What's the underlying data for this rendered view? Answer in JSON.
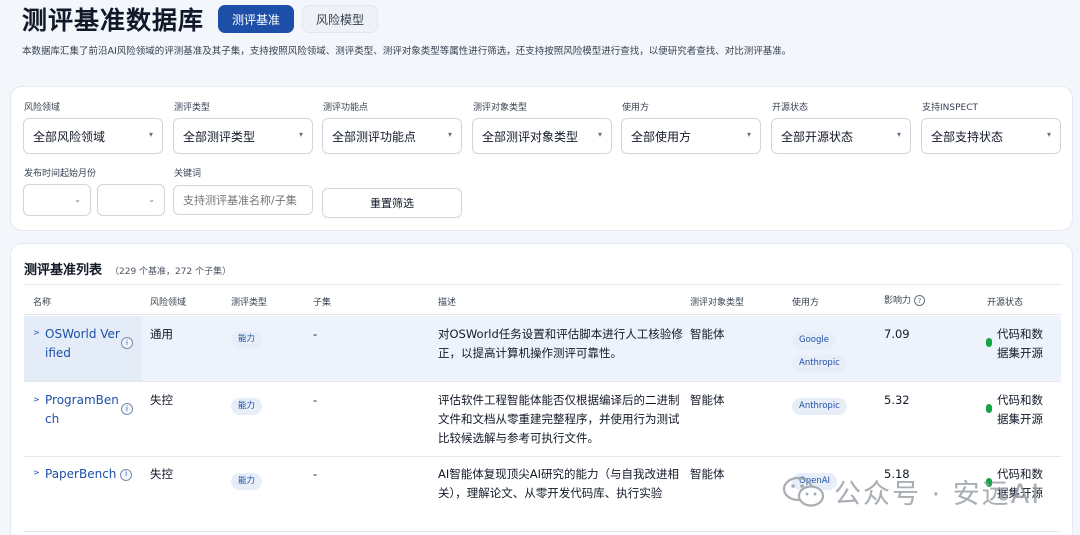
{
  "header": {
    "title": "测评基准数据库",
    "tabs": [
      {
        "label": "测评基准",
        "active": true
      },
      {
        "label": "风险模型",
        "active": false
      }
    ],
    "subtitle": "本数据库汇集了前沿AI风险领域的评测基准及其子集，支持按照风险领域、测评类型、测评对象类型等属性进行筛选，还支持按照风险模型进行查找，以便研究者查找、对比测评基准。"
  },
  "filters": {
    "risk_domain": {
      "label": "风险领域",
      "value": "全部风险领域"
    },
    "eval_type": {
      "label": "测评类型",
      "value": "全部测评类型"
    },
    "eval_function": {
      "label": "测评功能点",
      "value": "全部测评功能点"
    },
    "eval_target": {
      "label": "测评对象类型",
      "value": "全部测评对象类型"
    },
    "user": {
      "label": "使用方",
      "value": "全部使用方"
    },
    "open_source": {
      "label": "开源状态",
      "value": "全部开源状态"
    },
    "inspect": {
      "label": "支持INSPECT",
      "value": "全部支持状态"
    },
    "start_month": {
      "label": "发布时间起始月份",
      "year": "",
      "month": ""
    },
    "keyword": {
      "label": "关键词",
      "placeholder": "支持测评基准名称/子集"
    },
    "reset_label": "重置筛选"
  },
  "list": {
    "title": "测评基准列表",
    "count": "（229 个基准，272 个子集）",
    "columns": {
      "name": "名称",
      "risk": "风险领域",
      "type": "测评类型",
      "subset": "子集",
      "desc": "描述",
      "target": "测评对象类型",
      "user": "使用方",
      "impact": "影响力",
      "open": "开源状态"
    },
    "rows": [
      {
        "name": "OSWorld Verified",
        "risk": "通用",
        "type": "能力",
        "subset": "-",
        "desc": "对OSWorld任务设置和评估脚本进行人工核验修正，以提高计算机操作测评可靠性。",
        "target": "智能体",
        "users": [
          "Google",
          "Anthropic"
        ],
        "impact": "7.09",
        "open": "代码和数据集开源"
      },
      {
        "name": "ProgramBench",
        "risk": "失控",
        "type": "能力",
        "subset": "-",
        "desc": "评估软件工程智能体能否仅根据编译后的二进制文件和文档从零重建完整程序，并使用行为测试比较候选解与参考可执行文件。",
        "target": "智能体",
        "users": [
          "Anthropic"
        ],
        "impact": "5.32",
        "open": "代码和数据集开源"
      },
      {
        "name": "PaperBench",
        "risk": "失控",
        "type": "能力",
        "subset": "-",
        "desc": "AI智能体复现顶尖AI研究的能力（与自我改进相关），理解论文、从零开发代码库、执行实验",
        "target": "智能体",
        "users": [
          "OpenAI"
        ],
        "impact": "5.18",
        "open": "代码和数据集开源"
      }
    ]
  },
  "icons": {
    "expand": "expand-arrow-icon",
    "info": "info-icon",
    "help": "help-circle-icon",
    "status": "status-dot-icon"
  },
  "watermark": {
    "text": "公众号 · 安远AI"
  },
  "colors": {
    "accent": "#1e4fa8",
    "status_green": "#16a34a",
    "row_highlight": "#eef3fb"
  }
}
